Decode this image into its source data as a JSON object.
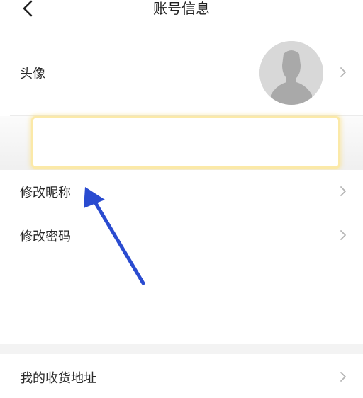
{
  "header": {
    "title": "账号信息",
    "back_icon": "chevron-left-icon"
  },
  "rows": {
    "avatar": {
      "label": "头像"
    },
    "nickname": {
      "label": "修改昵称"
    },
    "password": {
      "label": "修改密码"
    },
    "address": {
      "label": "我的收货地址"
    }
  },
  "colors": {
    "annotation_arrow": "#2a4bd0",
    "highlight_border": "#fbe9a8",
    "chevron": "#b5b5b5"
  }
}
